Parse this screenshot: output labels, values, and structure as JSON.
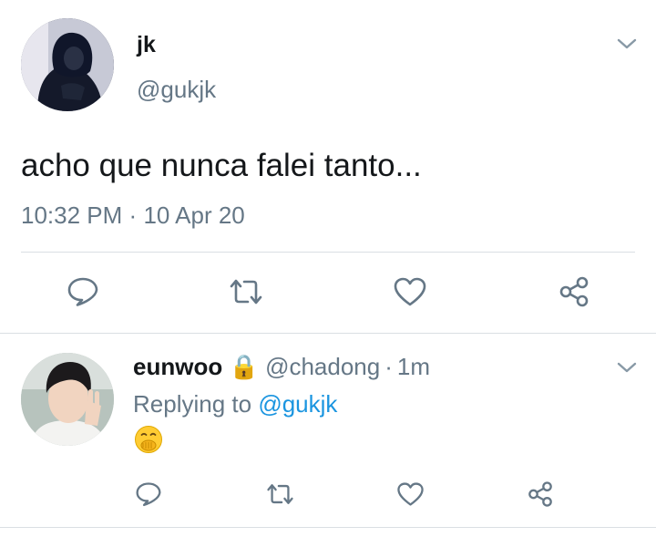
{
  "tweet": {
    "author_name": "jk",
    "author_handle": "@gukjk",
    "text": "acho que nunca falei tanto...",
    "time": "10:32 PM",
    "separator": "·",
    "date": "10 Apr 20"
  },
  "reply": {
    "author_name": "eunwoo",
    "lock_emoji": "🔒",
    "author_handle": "@chadong",
    "separator": "·",
    "age": "1m",
    "replying_prefix": "Replying to ",
    "replying_handle": "@gukjk",
    "emoji_name": "face-with-hand-over-mouth"
  },
  "icons": {
    "reply": "comment-icon",
    "retweet": "retweet-icon",
    "like": "heart-icon",
    "share": "share-icon",
    "menu": "chevron-down-icon"
  },
  "colors": {
    "text": "#14171a",
    "secondary": "#657786",
    "link": "#1b95e0",
    "divider": "#dadfe3"
  }
}
